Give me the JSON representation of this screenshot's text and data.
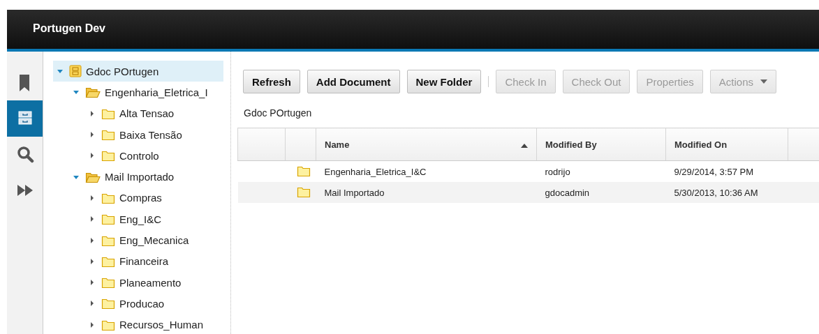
{
  "app": {
    "title": "Portugen Dev"
  },
  "rail": [
    {
      "kind": "bookmark",
      "selected": false
    },
    {
      "kind": "cabinet",
      "selected": true
    },
    {
      "kind": "search",
      "selected": false
    },
    {
      "kind": "forward",
      "selected": false
    }
  ],
  "tree": [
    {
      "label": "Gdoc POrtugen",
      "kind": "repository",
      "expanded": true,
      "selected": true,
      "children": [
        {
          "label": "Engenharia_Eletrica_I",
          "kind": "folder",
          "expanded": true,
          "selected": false,
          "children": [
            {
              "label": "Alta Tensao",
              "kind": "folder",
              "expanded": false,
              "selected": false
            },
            {
              "label": "Baixa Tensão",
              "kind": "folder",
              "expanded": false,
              "selected": false
            },
            {
              "label": "Controlo",
              "kind": "folder",
              "expanded": false,
              "selected": false
            }
          ]
        },
        {
          "label": "Mail Importado",
          "kind": "folder",
          "expanded": true,
          "selected": false,
          "children": [
            {
              "label": "Compras",
              "kind": "folder",
              "expanded": false,
              "selected": false
            },
            {
              "label": "Eng_I&C",
              "kind": "folder",
              "expanded": false,
              "selected": false
            },
            {
              "label": "Eng_Mecanica",
              "kind": "folder",
              "expanded": false,
              "selected": false
            },
            {
              "label": "Financeira",
              "kind": "folder",
              "expanded": false,
              "selected": false
            },
            {
              "label": "Planeamento",
              "kind": "folder",
              "expanded": false,
              "selected": false
            },
            {
              "label": "Producao",
              "kind": "folder",
              "expanded": false,
              "selected": false
            },
            {
              "label": "Recursos_Human",
              "kind": "folder",
              "expanded": false,
              "selected": false
            }
          ]
        }
      ]
    }
  ],
  "toolbar": [
    [
      {
        "label": "Refresh",
        "kind": "button",
        "disabled": false
      },
      {
        "label": "Add Document",
        "kind": "button",
        "disabled": false
      },
      {
        "label": "New Folder",
        "kind": "button",
        "disabled": false
      }
    ],
    [
      {
        "label": "Check In",
        "kind": "button",
        "disabled": true
      },
      {
        "label": "Check Out",
        "kind": "button",
        "disabled": true
      },
      {
        "label": "Properties",
        "kind": "button",
        "disabled": true
      },
      {
        "label": "Actions",
        "kind": "menu",
        "disabled": true
      }
    ]
  ],
  "breadcrumb": "Gdoc POrtugen",
  "table": {
    "columns": [
      {
        "label": "Name",
        "sorted": true
      },
      {
        "label": "Modified By",
        "sorted": false
      },
      {
        "label": "Modified On",
        "sorted": false
      }
    ],
    "rows": [
      {
        "kind": "folder",
        "name": "Engenharia_Eletrica_I&C",
        "modified_by": "rodrijo",
        "modified_on": "9/29/2014, 3:57 PM"
      },
      {
        "kind": "folder",
        "name": "Mail Importado",
        "modified_by": "gdocadmin",
        "modified_on": "5/30/2013, 10:36 AM"
      }
    ]
  }
}
